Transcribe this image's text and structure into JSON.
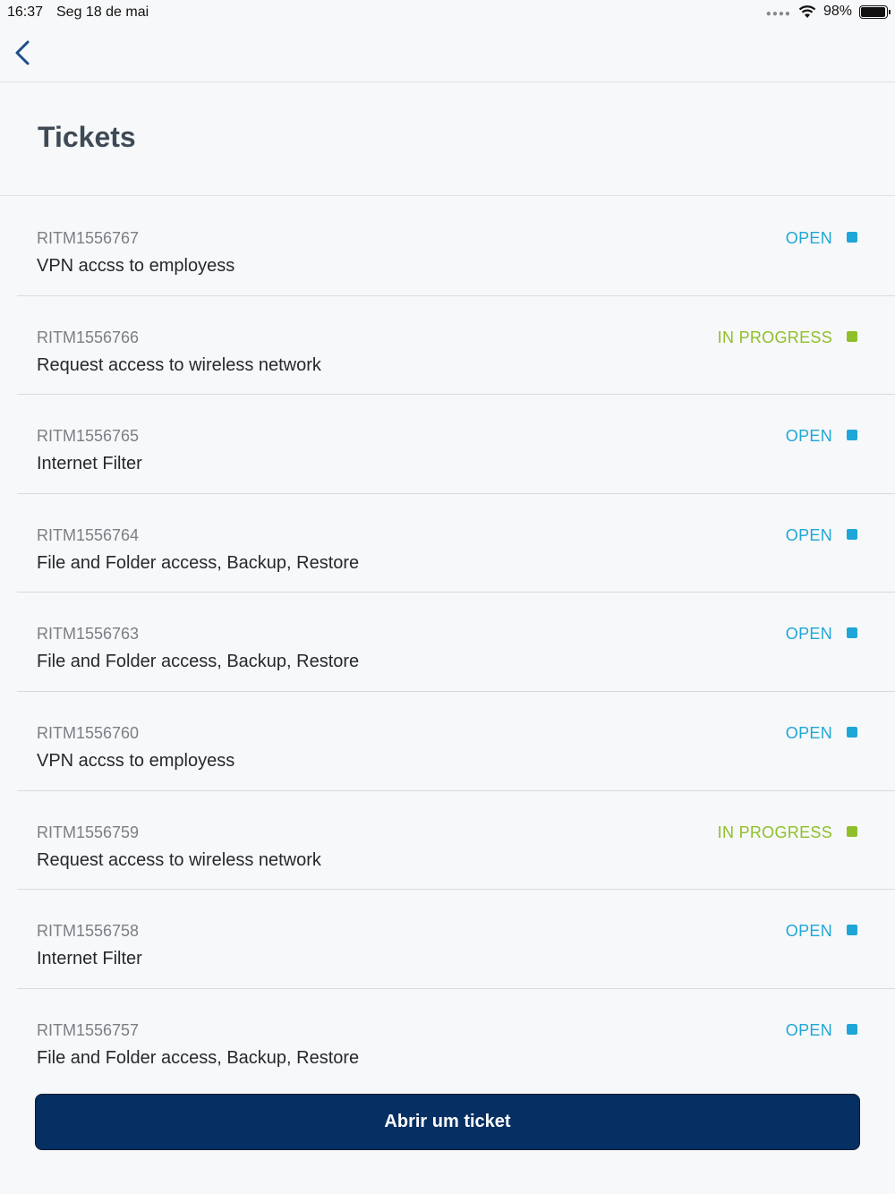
{
  "status_bar": {
    "time": "16:37",
    "date": "Seg 18 de mai",
    "battery": "98%",
    "battery_level": 0.98
  },
  "nav": {
    "back_icon": "chevron-left-icon"
  },
  "header": {
    "title": "Tickets"
  },
  "colors": {
    "open": "#1fa6d8",
    "in_progress": "#8fbf2a",
    "primary": "#062f63"
  },
  "tickets": [
    {
      "id": "RITM1556767",
      "title": "VPN accss to employess",
      "status": "OPEN",
      "status_type": "open"
    },
    {
      "id": "RITM1556766",
      "title": "Request access to wireless network",
      "status": "IN PROGRESS",
      "status_type": "in_progress"
    },
    {
      "id": "RITM1556765",
      "title": "Internet Filter",
      "status": "OPEN",
      "status_type": "open"
    },
    {
      "id": "RITM1556764",
      "title": "File and Folder access, Backup, Restore",
      "status": "OPEN",
      "status_type": "open"
    },
    {
      "id": "RITM1556763",
      "title": "File and Folder access, Backup, Restore",
      "status": "OPEN",
      "status_type": "open"
    },
    {
      "id": "RITM1556760",
      "title": "VPN accss to employess",
      "status": "OPEN",
      "status_type": "open"
    },
    {
      "id": "RITM1556759",
      "title": "Request access to wireless network",
      "status": "IN PROGRESS",
      "status_type": "in_progress"
    },
    {
      "id": "RITM1556758",
      "title": "Internet Filter",
      "status": "OPEN",
      "status_type": "open"
    },
    {
      "id": "RITM1556757",
      "title": "File and Folder access, Backup, Restore",
      "status": "OPEN",
      "status_type": "open"
    }
  ],
  "actions": {
    "open_ticket_label": "Abrir um ticket"
  }
}
